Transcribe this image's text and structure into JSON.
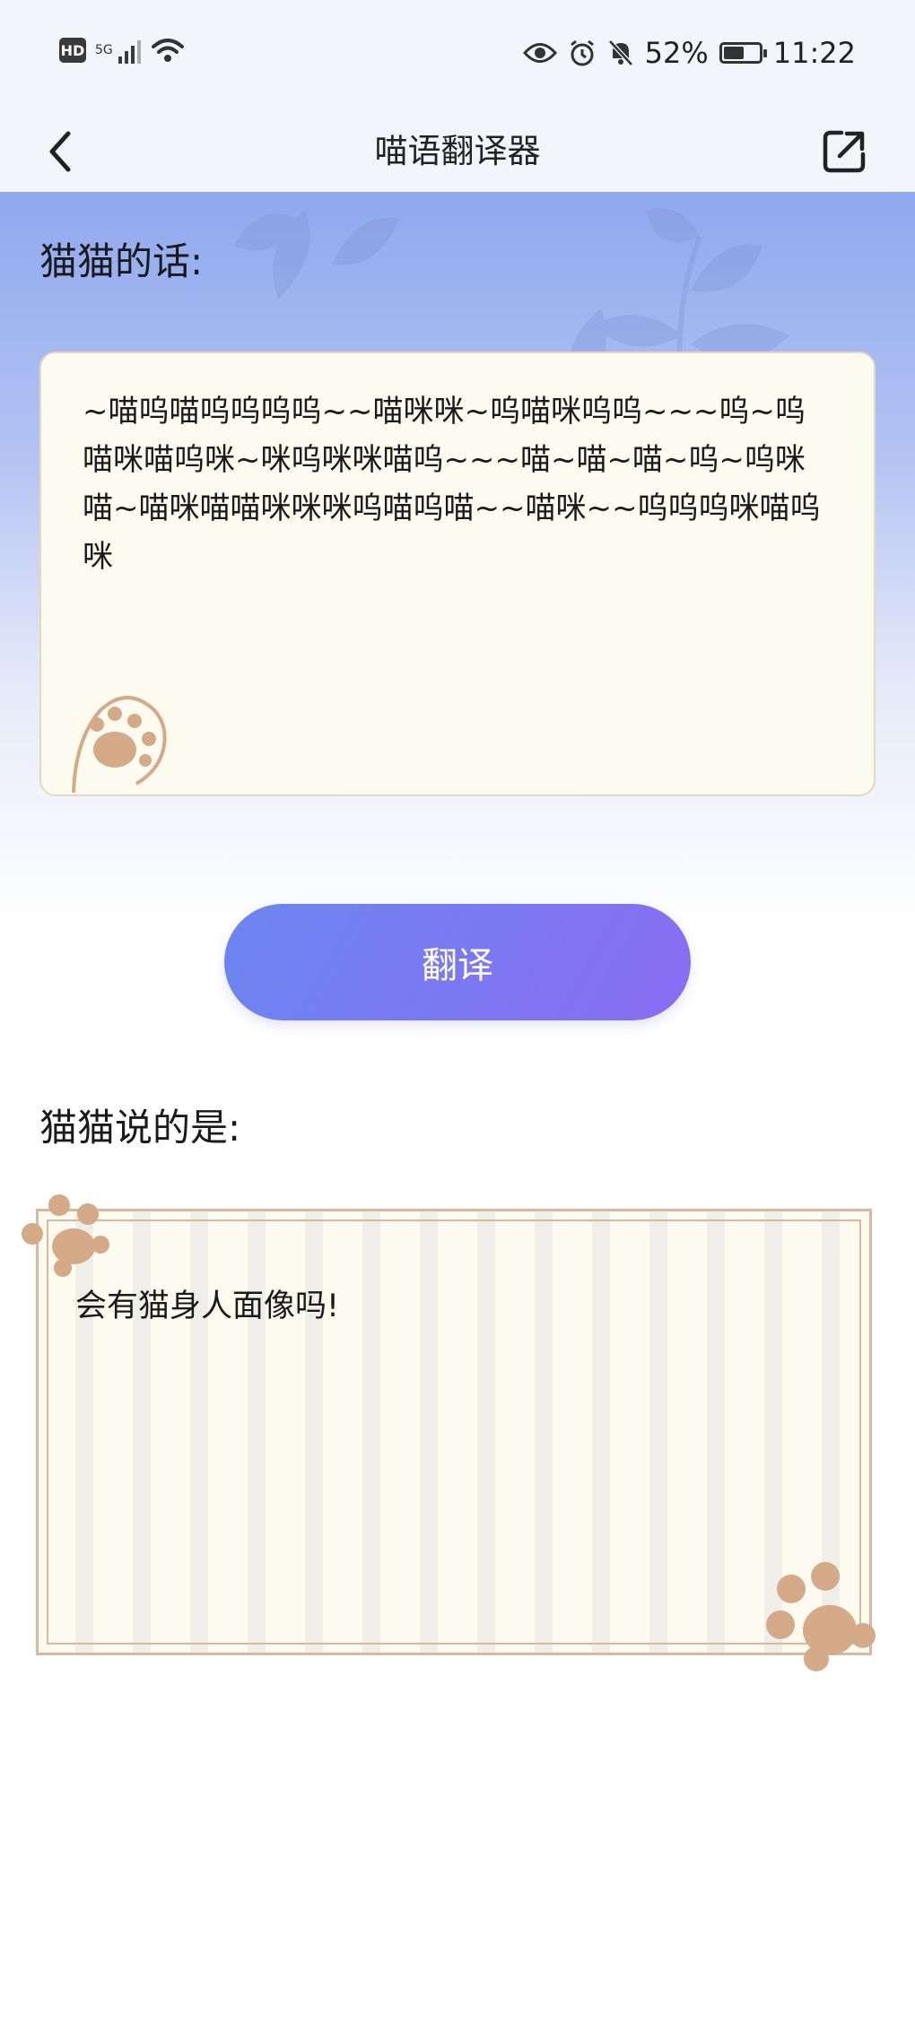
{
  "status_bar": {
    "hd": "HD",
    "network": "5G",
    "battery_text": "52%",
    "battery_level": 0.52,
    "time": "11:22"
  },
  "header": {
    "title": "喵语翻译器",
    "back_icon": "chevron-left-icon",
    "share_icon": "share-external-icon"
  },
  "input_section": {
    "label": "猫猫的话:",
    "text": "~喵呜喵呜呜呜呜~~喵咪咪~呜喵咪呜呜~~~呜~呜喵咪喵呜咪~咪呜咪咪喵呜~~~喵~喵~喵~呜~呜咪喵~喵咪喵喵咪咪咪呜喵呜喵~~喵咪~~呜呜呜咪喵呜咪"
  },
  "translate_button": {
    "label": "翻译"
  },
  "result_section": {
    "label": "猫猫说的是:",
    "text": "会有猫身人面像吗!"
  },
  "colors": {
    "accent_start": "#6b86f0",
    "accent_end": "#8a6cf3",
    "paw": "#d4aa88",
    "hero_top": "#8fa9ee"
  }
}
